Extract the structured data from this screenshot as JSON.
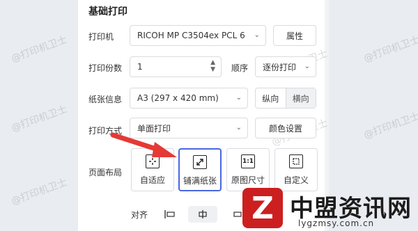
{
  "section_title": "基础打印",
  "watermarks": [
    "@打印机卫士",
    "@打印机卫士",
    "@打印机卫士",
    "@打印机卫士",
    "@打印机卫士",
    "@打印机卫士",
    "@打印机卫士"
  ],
  "printer": {
    "label": "打印机",
    "value": "RICOH MP C3504ex PCL 6",
    "props_button": "属性"
  },
  "copies": {
    "label": "打印份数",
    "value": "1",
    "order_label": "顺序",
    "order_value": "逐份打印"
  },
  "paper": {
    "label": "纸张信息",
    "value": "A3 (297 x 420 mm)",
    "portrait": "纵向",
    "landscape": "横向"
  },
  "mode": {
    "label": "打印方式",
    "value": "单面打印",
    "color_button": "颜色设置"
  },
  "layout": {
    "label": "页面布局",
    "options": [
      {
        "label": "自适应",
        "icon": "fit-icon"
      },
      {
        "label": "铺满纸张",
        "icon": "fill-icon"
      },
      {
        "label": "原图尺寸",
        "icon": "original-size-icon",
        "icon_text": "1:1"
      },
      {
        "label": "自定义",
        "icon": "custom-icon"
      }
    ],
    "selected": "铺满纸张"
  },
  "align": {
    "label": "对齐"
  },
  "brand": {
    "name": "中盟资讯网",
    "url": "lygzmsy.com.cn"
  },
  "colors": {
    "accent": "#4a66e0",
    "brand_red": "#cc1f1f",
    "arrow_red": "#e53935"
  }
}
